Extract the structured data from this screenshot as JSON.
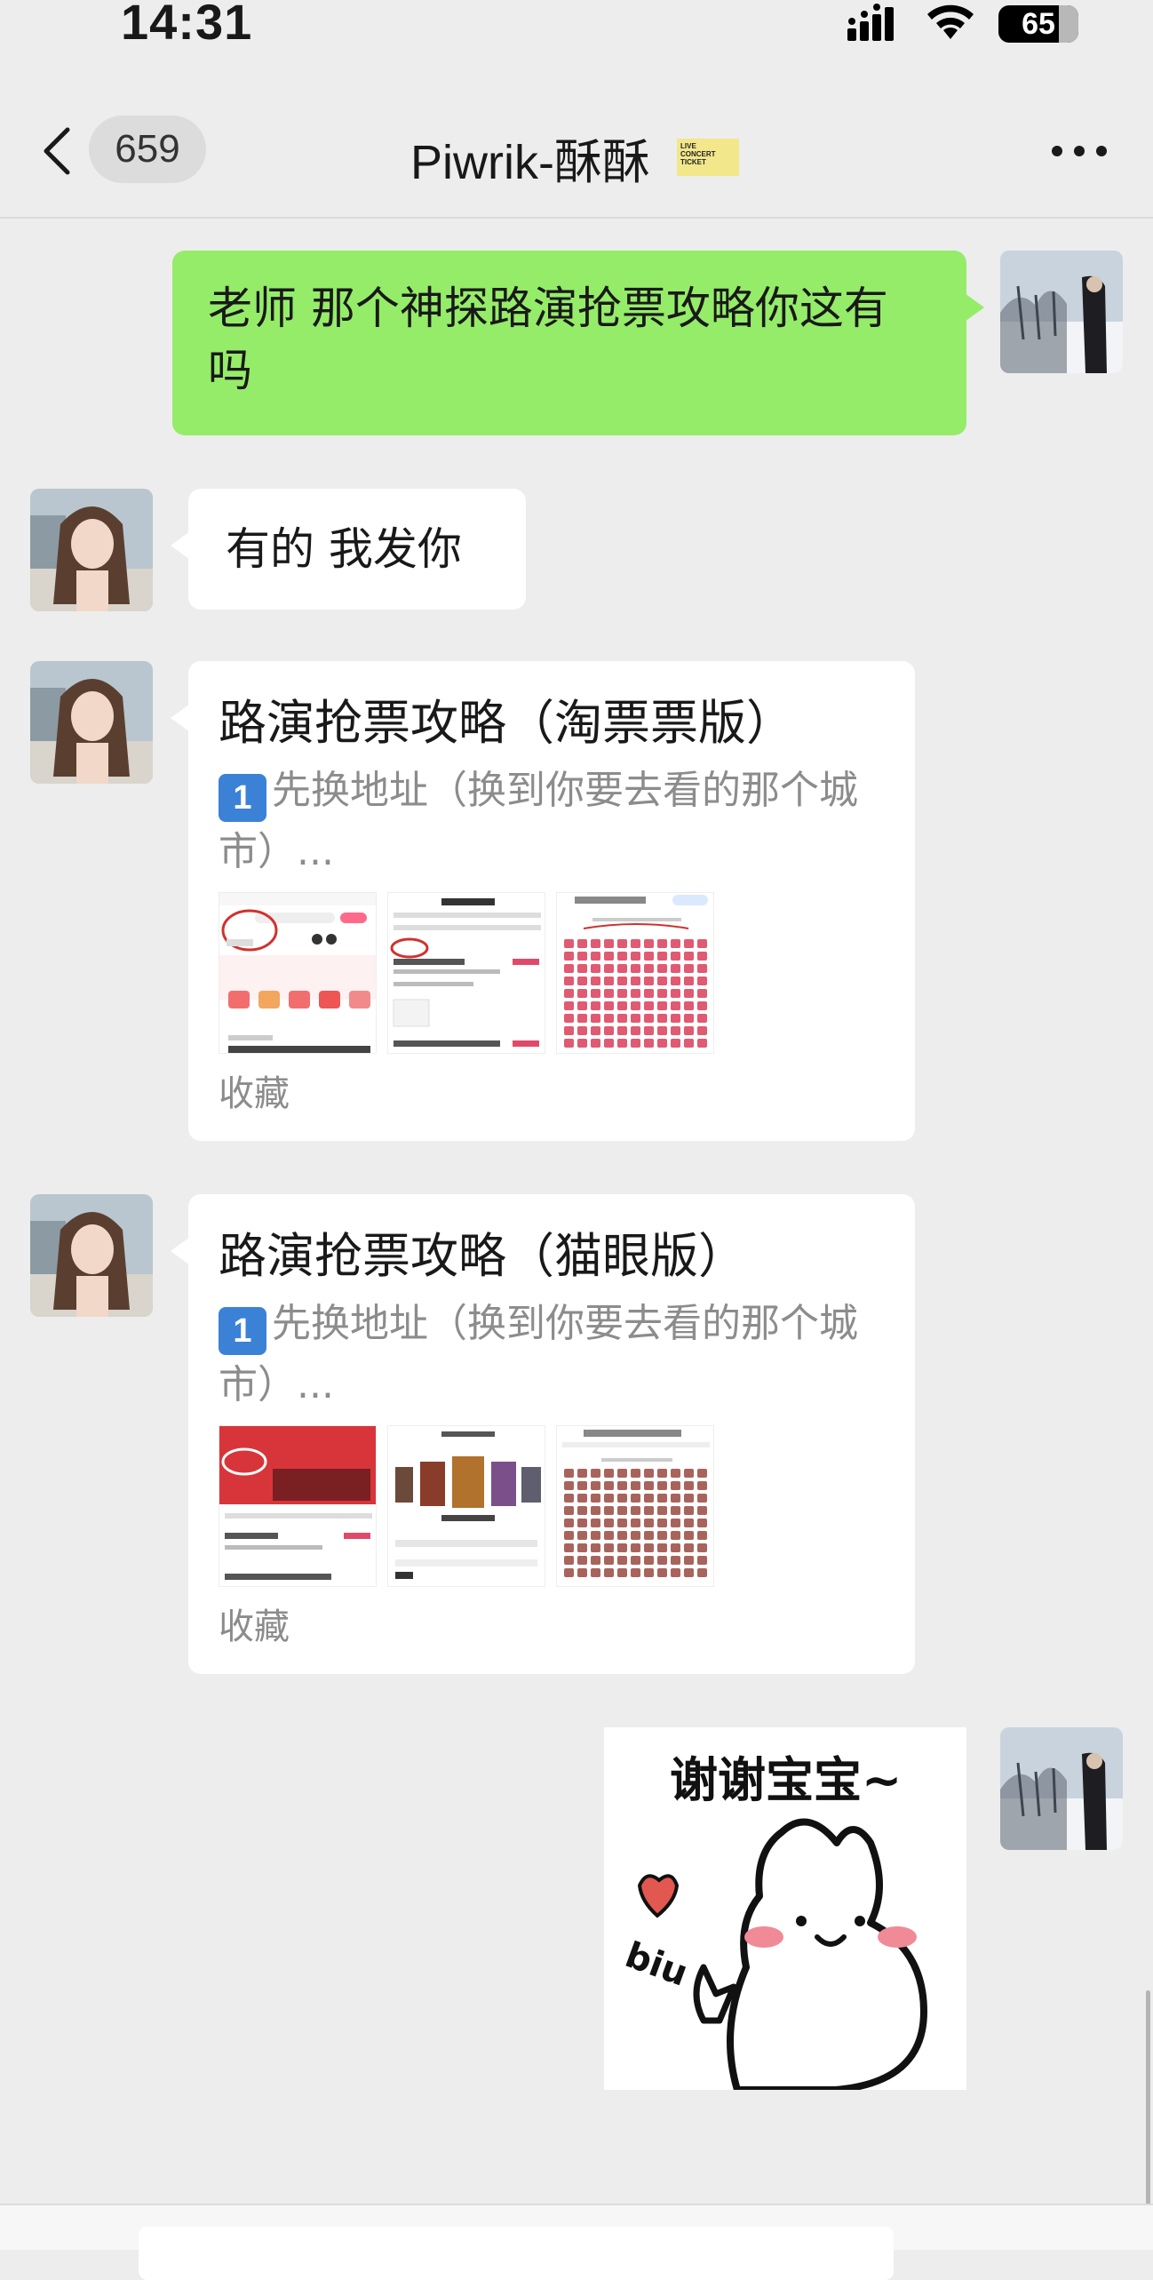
{
  "status_bar": {
    "time": "14:31",
    "battery": "65"
  },
  "nav": {
    "unread_count": "659",
    "title": "Piwrik-酥酥",
    "badge_lines": [
      "LIVE",
      "CONCERT",
      "TICKET"
    ]
  },
  "messages": {
    "m1_text": "老师 那个神探路演抢票攻略你这有吗",
    "m2_text": "有的 我发你",
    "card1": {
      "title": "路演抢票攻略（淘票票版）",
      "desc_keycap": "1",
      "desc_text": "先换地址（换到你要去看的那个城市）...",
      "footer": "收藏"
    },
    "card2": {
      "title": "路演抢票攻略（猫眼版）",
      "desc_keycap": "1",
      "desc_text": "先换地址（换到你要去看的那个城市）...",
      "footer": "收藏"
    },
    "sticker_text": "谢谢宝宝~",
    "sticker_sub": "biu"
  },
  "colors": {
    "background": "#ededed",
    "sent_bubble": "#95ec69",
    "received_bubble": "#ffffff",
    "muted_text": "#8c8c8c"
  },
  "icons": [
    "back-chevron-icon",
    "more-dots-icon",
    "signal-icon",
    "wifi-icon",
    "battery-icon"
  ]
}
